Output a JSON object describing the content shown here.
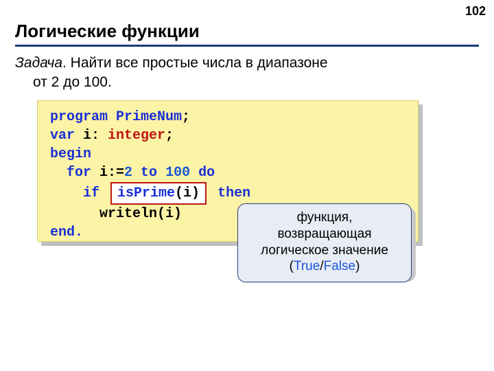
{
  "page_number": "102",
  "heading": "Логические функции",
  "task": {
    "label": "Задача",
    "sep": ". ",
    "line1_rest": "Найти все простые числа в диапазоне",
    "line2": "от 2 до 100."
  },
  "code": {
    "l1_program": "program",
    "l1_name": " PrimeNum",
    "l1_semi": ";",
    "l2_var": "var",
    "l2_mid": " i: ",
    "l2_type": "integer",
    "l2_semi": ";",
    "l3_begin": "begin",
    "l4_for": "for",
    "l4_a": " i:=",
    "l4_n1": "2",
    "l4_to": " to ",
    "l4_n2": "100",
    "l4_do": " do",
    "l5_if": "if",
    "l5_box_fn": "isPrime",
    "l5_box_arg": "(i)",
    "l5_then": "then",
    "l6_writeln": "writeln(i)",
    "l7_end": "end."
  },
  "callout": {
    "t1": "функция,",
    "t2": "возвращающая",
    "t3": "логическое значение",
    "paren_open": "(",
    "true": "True",
    "slash": "/",
    "false": "False",
    "paren_close": ")"
  }
}
